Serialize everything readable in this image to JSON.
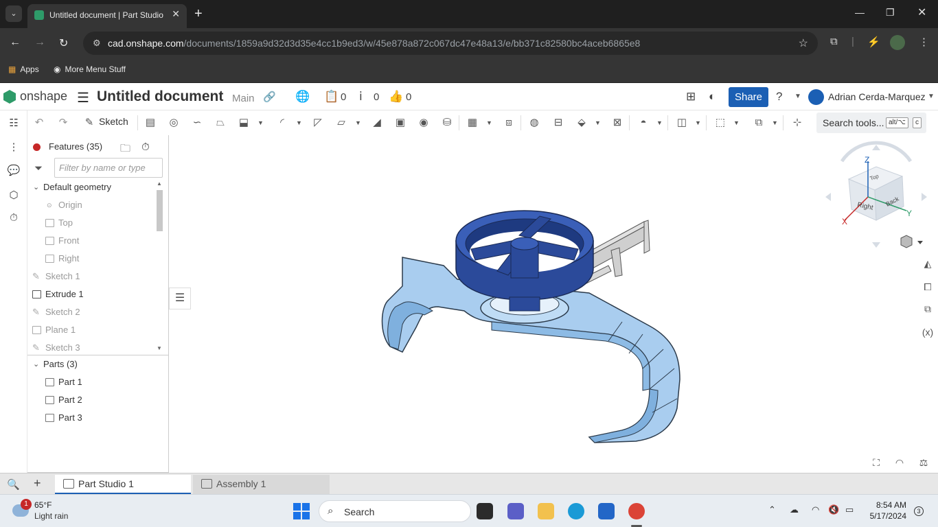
{
  "browser": {
    "tab_title": "Untitled document | Part Studio",
    "url_domain": "cad.onshape.com",
    "url_path": "/documents/1859a9d32d3d35e4cc1b9ed3/w/45e878a872c067dc47e48a13/e/bb371c82580bc4aceb6865e8",
    "bookmarks": [
      "Apps",
      "More Menu Stuff"
    ]
  },
  "header": {
    "logo_text": "onshape",
    "doc_title": "Untitled document",
    "branch": "Main",
    "versions_count": "0",
    "comments_count": "0",
    "likes_count": "0",
    "share_label": "Share",
    "user_name": "Adrian Cerda-Marquez"
  },
  "toolbar": {
    "sketch_label": "Sketch",
    "search_label": "Search tools...",
    "shortcut_1": "alt/⌥",
    "shortcut_2": "c"
  },
  "feature_panel": {
    "title": "Features (35)",
    "filter_placeholder": "Filter by name or type",
    "tree": [
      {
        "label": "Default geometry",
        "kind": "group"
      },
      {
        "label": "Origin",
        "kind": "origin"
      },
      {
        "label": "Top",
        "kind": "plane"
      },
      {
        "label": "Front",
        "kind": "plane"
      },
      {
        "label": "Right",
        "kind": "plane"
      },
      {
        "label": "Sketch 1",
        "kind": "sketch"
      },
      {
        "label": "Extrude 1",
        "kind": "extrude"
      },
      {
        "label": "Sketch 2",
        "kind": "sketch"
      },
      {
        "label": "Plane 1",
        "kind": "plane"
      },
      {
        "label": "Sketch 3",
        "kind": "sketch"
      }
    ],
    "parts_title": "Parts (3)",
    "parts": [
      "Part 1",
      "Part 2",
      "Part 3"
    ]
  },
  "view_cube": {
    "axis_z": "Z",
    "axis_x": "X",
    "axis_y": "Y",
    "face_right": "Right",
    "face_back": "Back",
    "face_top": "Top"
  },
  "bottom_tabs": [
    "Part Studio 1",
    "Assembly 1"
  ],
  "taskbar": {
    "weather_badge": "1",
    "temperature": "65°F",
    "condition": "Light rain",
    "search_label": "Search",
    "time": "8:54 AM",
    "date": "5/17/2024",
    "notifications": "3"
  },
  "colors": {
    "accent": "#1b5fb4",
    "onshape_green": "#2e9b69",
    "part_dark_blue": "#2b4a9a",
    "part_light_blue": "#a9cdef",
    "part_gray": "#d0d0d0"
  }
}
